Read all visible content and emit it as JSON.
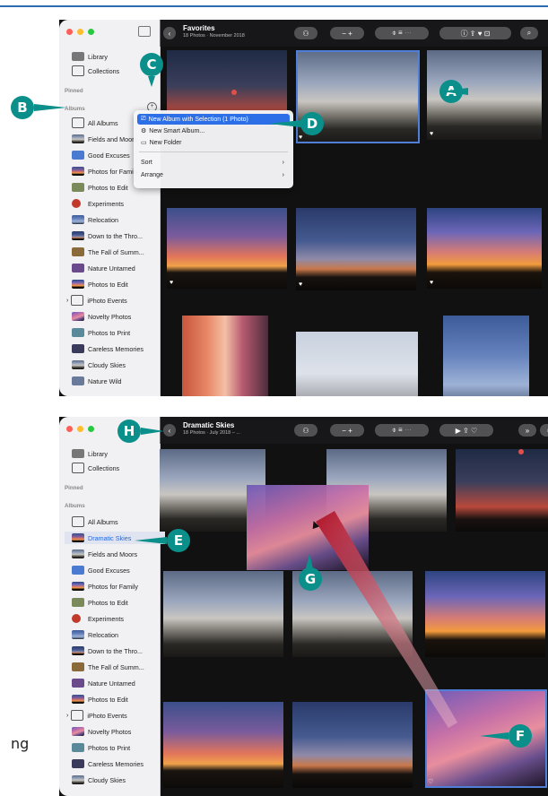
{
  "side_text": "ng",
  "screen1": {
    "toolbar": {
      "title": "Favorites",
      "subtitle": "18 Photos · November 2018"
    },
    "sidebar": {
      "top_items": [
        "Library",
        "Collections"
      ],
      "pinned_header": "Pinned",
      "albums_header": "Albums",
      "albums": [
        "All Albums",
        "Fields and Moors",
        "Good Excuses",
        "Photos for Family",
        "Photos to Edit",
        "Experiments",
        "Relocation",
        "Down to the Thro...",
        "The Fall of Summ...",
        "Nature Untamed",
        "Photos to Edit",
        "iPhoto Events",
        "Novelty Photos",
        "Photos to Print",
        "Careless Memories",
        "Cloudy Skies",
        "Nature Wild"
      ]
    },
    "context_menu": {
      "items": [
        "New Album with Selection (1 Photo)",
        "New Smart Album...",
        "New Folder"
      ],
      "sub_items": [
        "Sort",
        "Arrange"
      ]
    }
  },
  "screen2": {
    "toolbar": {
      "title": "Dramatic Skies",
      "subtitle": "18 Photos · July 2018 – ..."
    },
    "sidebar": {
      "top_items": [
        "Library",
        "Collections"
      ],
      "pinned_header": "Pinned",
      "albums_header": "Albums",
      "albums": [
        "All Albums",
        "Dramatic Skies",
        "Fields and Moors",
        "Good Excuses",
        "Photos for Family",
        "Photos to Edit",
        "Experiments",
        "Relocation",
        "Down to the Thro...",
        "The Fall of Summ...",
        "Nature Untamed",
        "Photos to Edit",
        "iPhoto Events",
        "Novelty Photos",
        "Photos to Print",
        "Careless Memories",
        "Cloudy Skies"
      ]
    }
  },
  "callouts": [
    "A",
    "B",
    "C",
    "D",
    "E",
    "F",
    "G",
    "H"
  ],
  "colors": {
    "callout": "#0a8f8a",
    "selection": "#2d6fe6"
  }
}
